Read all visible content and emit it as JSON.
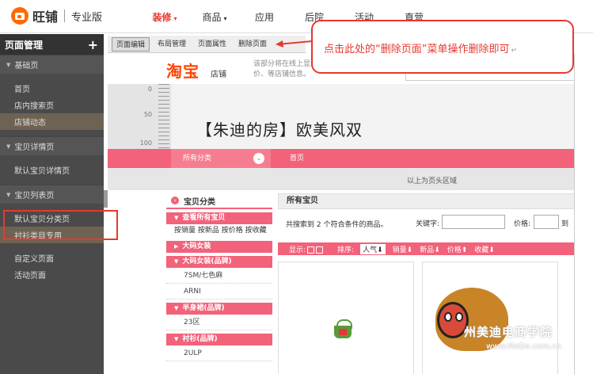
{
  "app": {
    "logo_text": "旺铺",
    "edition": "专业版"
  },
  "topnav": {
    "items": [
      {
        "label": "装修",
        "caret": "▾"
      },
      {
        "label": "商品",
        "caret": "▾"
      },
      {
        "label": "应用",
        "caret": ""
      },
      {
        "label": "后院",
        "caret": ""
      },
      {
        "label": "活动",
        "caret": ""
      },
      {
        "label": "直营",
        "caret": ""
      }
    ]
  },
  "sidebar": {
    "title": "页面管理",
    "add": "+",
    "group1": "基础页",
    "item_home": "首页",
    "item_search": "店内搜索页",
    "item_dynamic": "店铺动态",
    "group2": "宝贝详情页",
    "item_default_detail": "默认宝贝详情页",
    "group3": "宝贝列表页",
    "item_default_cat": "默认宝贝分类页",
    "item_shirt": "衬衫类目专用",
    "item_custom": "自定义页面",
    "item_activity": "活动页面"
  },
  "toolbar": {
    "edit": "页面编辑",
    "layout": "布局管理",
    "props": "页面属性",
    "delete": "删除页面"
  },
  "shop": {
    "tb_logo": "淘宝",
    "tb_sub": "店铺",
    "desc": "该部分将在线上显示店铺名称、评价、等店铺信息。",
    "ruler_0": "0",
    "ruler_50": "50",
    "ruler_100": "100",
    "banner_title": "【朱迪的房】欧美风双",
    "nav_all": "所有分类",
    "nav_btn": "⌄",
    "nav_home": "首页",
    "header_zone": "以上为页头区域"
  },
  "category": {
    "title": "宝贝分类",
    "icon": "›",
    "all_items": "查看所有宝贝",
    "sort_links": "按销量 按新品 按价格 按收藏",
    "bar_big": "大码女装",
    "bar_big_brand": "大码女装(品牌)",
    "sub_7sm": "7SM/七色麻",
    "sub_arni": "ARNI",
    "bar_skirt": "半身裙(品牌)",
    "sub_23": "23区",
    "bar_shirt": "衬衫(品牌)",
    "sub_2ulp": "2ULP"
  },
  "main": {
    "all_title": "所有宝贝",
    "count_text": "共搜索到 2 个符合条件的商品。",
    "kw_label": "关键字:",
    "price_label": "价格:",
    "price_to": "到",
    "sort_view": "显示:",
    "sort_label": "排序:",
    "sort_items": [
      "人气⬇",
      "销量⬇",
      "新品⬇",
      "价格⬆",
      "收藏⬇"
    ]
  },
  "callout": {
    "text": "点击此处的“删除页面”菜单操作删除即可",
    "mark": "↵"
  },
  "watermark": {
    "text": "州美迪电商学院",
    "url": "www.MeDe.com.cn"
  }
}
